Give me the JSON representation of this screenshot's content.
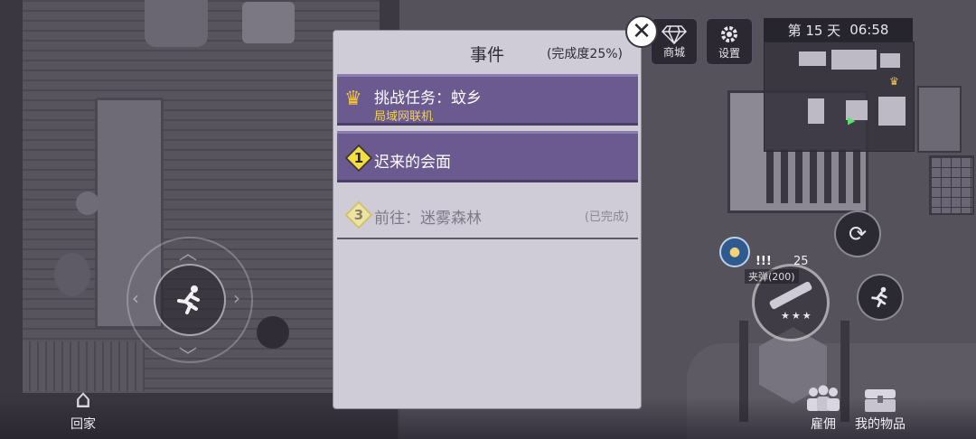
{
  "top_bar": {
    "shop_label": "商城",
    "settings_label": "设置",
    "day_label": "第 15 天",
    "time": "06:58"
  },
  "dialog": {
    "title": "事件",
    "progress": "(完成度25%)",
    "quests": [
      {
        "title": "挑战任务：蚊乡",
        "subtitle": "局域网联机",
        "icon": "crown-icon"
      },
      {
        "title": "迟来的会面",
        "number": "1",
        "icon": "yellow-diamond-icon"
      },
      {
        "title": "前往：迷雾森林",
        "number": "3",
        "status": "(已完成)",
        "icon": "pale-diamond-icon"
      }
    ]
  },
  "hud": {
    "ammo_label": "夹弹(200)",
    "ammo_count": "25",
    "alert_text": "!!!"
  },
  "bottom_bar": {
    "home_label": "回家",
    "hire_label": "雇佣",
    "items_label": "我的物品"
  },
  "colors": {
    "quest_bg": "#6a5a8f",
    "subtitle_yellow": "#f2d24f",
    "dialog_bg": "#cfccd8"
  }
}
